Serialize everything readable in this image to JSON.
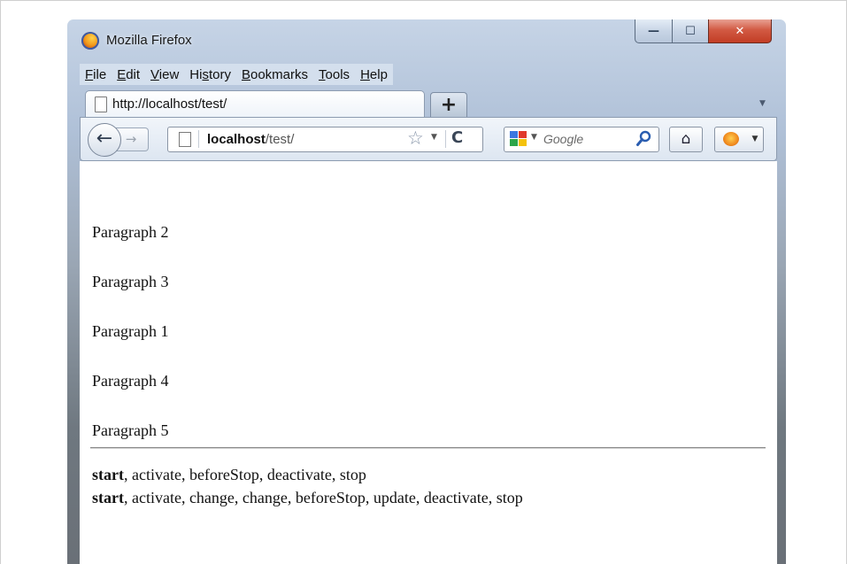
{
  "window": {
    "title": "Mozilla Firefox",
    "controls": {
      "minimize": "—",
      "maximize": "☐",
      "close": "✕"
    }
  },
  "menu": [
    {
      "label": "File",
      "access_key": "F",
      "rest": "ile"
    },
    {
      "label": "Edit",
      "access_key": "E",
      "rest": "dit"
    },
    {
      "label": "View",
      "access_key": "V",
      "rest": "iew"
    },
    {
      "label": "History",
      "pre": "Hi",
      "access_key": "s",
      "rest": "tory"
    },
    {
      "label": "Bookmarks",
      "access_key": "B",
      "rest": "ookmarks"
    },
    {
      "label": "Tools",
      "access_key": "T",
      "rest": "ools"
    },
    {
      "label": "Help",
      "access_key": "H",
      "rest": "elp"
    }
  ],
  "tabs": [
    {
      "label": "http://localhost/test/",
      "active": true
    }
  ],
  "new_tab_label": "+",
  "navbar": {
    "back_label": "←",
    "forward_label": "→",
    "url_host": "localhost",
    "url_path": "/test/",
    "star_icon": "☆",
    "reload_icon": "C",
    "search_placeholder": "Google",
    "home_icon": "⌂"
  },
  "content": {
    "paragraphs": [
      "Paragraph 2",
      "Paragraph 3",
      "Paragraph 1",
      "Paragraph 4",
      "Paragraph 5"
    ],
    "log": [
      {
        "strong": "start",
        "rest": ", activate, beforeStop, deactivate, stop"
      },
      {
        "strong": "start",
        "rest": ", activate, change, change, beforeStop, update, deactivate, stop"
      }
    ]
  },
  "colors": {
    "titlebar": "#b0c1d8",
    "close_button": "#c23d25",
    "content_bg": "#ffffff"
  }
}
